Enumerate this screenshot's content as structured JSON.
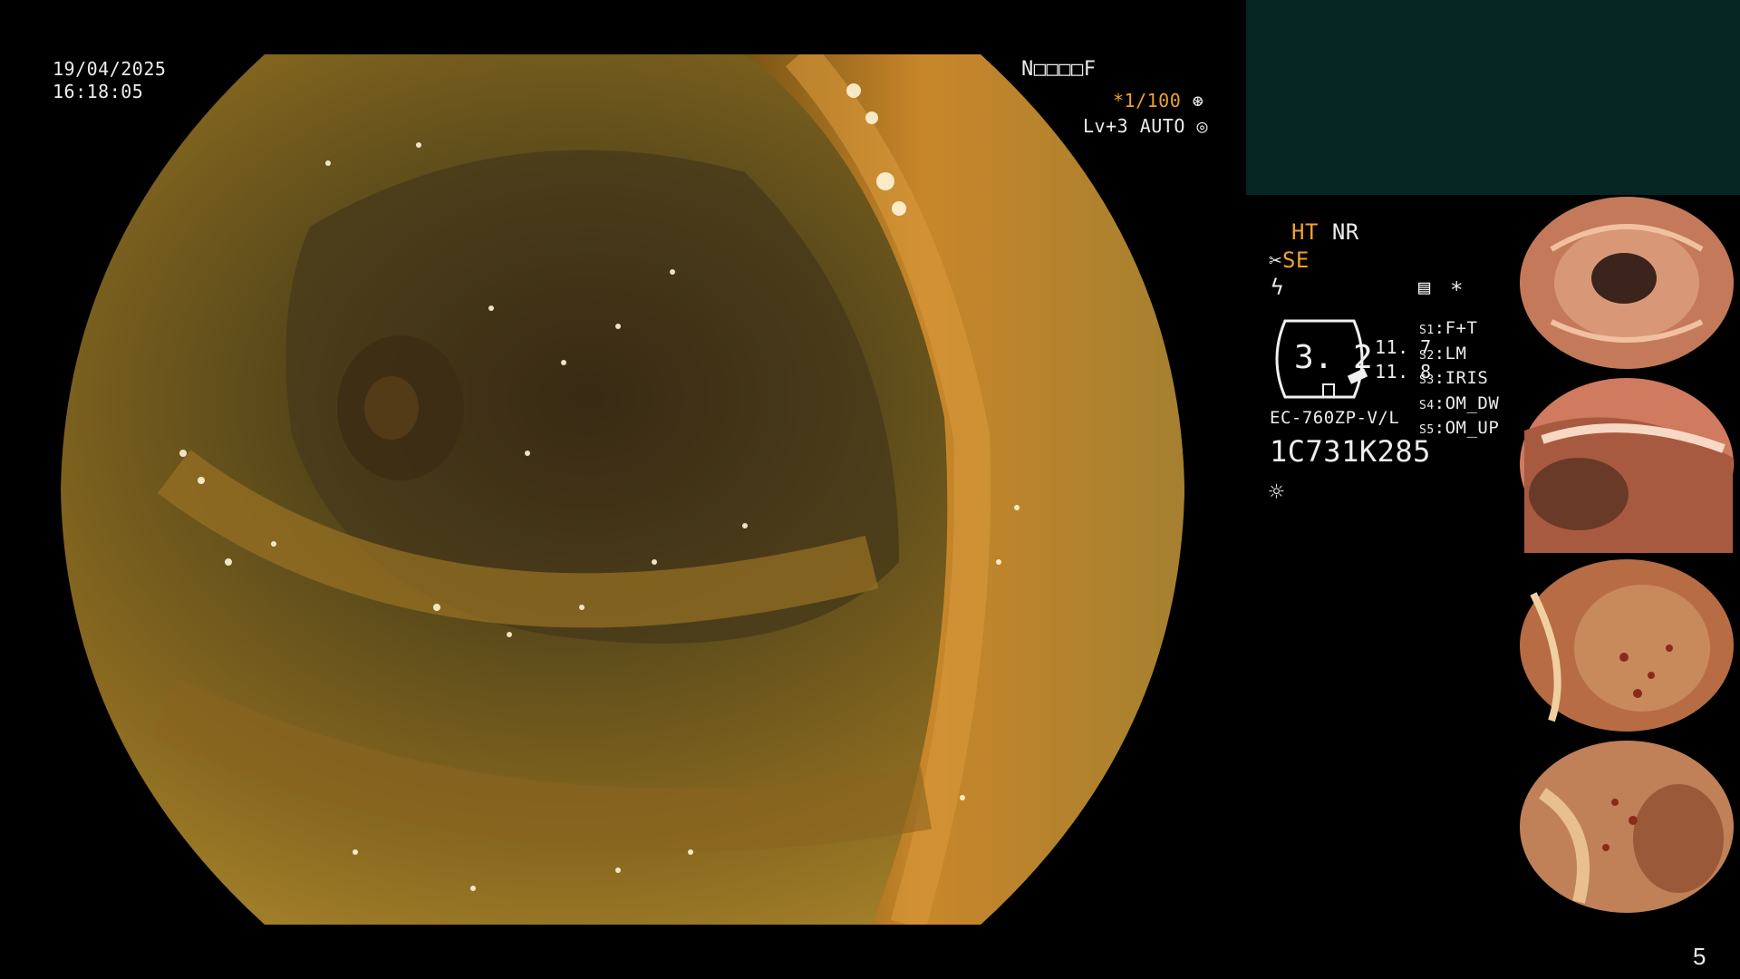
{
  "osd": {
    "date": "19/04/2025",
    "time": "16:18:05",
    "patient_code": "N□□□□F",
    "shutter": "*1/100",
    "light_level": "Lv+3",
    "iris_mode": "AUTO"
  },
  "panel": {
    "ht": "HT",
    "nr": "NR",
    "se": "SE",
    "asterisk": "*",
    "gauge_value": "3. 2",
    "reading_a": "11. 7",
    "reading_b": "11. 8",
    "scope_model": "EC-760ZP-V/L",
    "serial": "1C731K285",
    "switches": [
      {
        "key": "S1",
        "value": "F+T"
      },
      {
        "key": "S2",
        "value": "LM"
      },
      {
        "key": "S3",
        "value": "IRIS"
      },
      {
        "key": "S4",
        "value": "OM_DW"
      },
      {
        "key": "S5",
        "value": "OM_UP"
      }
    ]
  },
  "page_number": "5",
  "colors": {
    "accent_orange": "#f0a030",
    "panel_teal": "#062624"
  },
  "icons": [
    "shutter-icon",
    "iris-icon",
    "scissors-icon",
    "lightning-icon",
    "memory-icon",
    "light-icon"
  ]
}
